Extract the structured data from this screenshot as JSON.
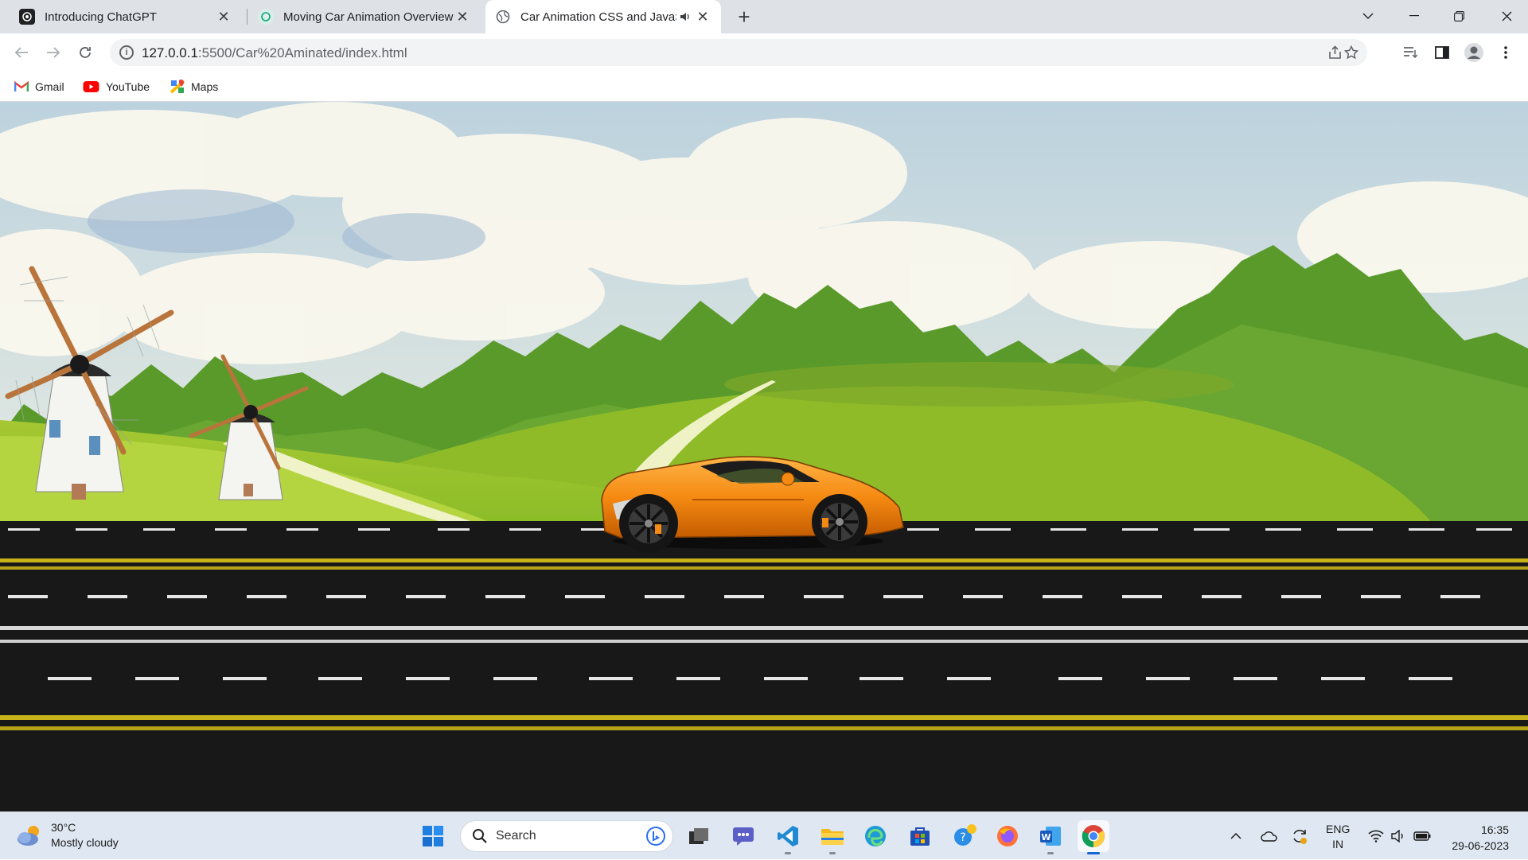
{
  "browser": {
    "tabs": [
      {
        "title": "Introducing ChatGPT",
        "close": "✕"
      },
      {
        "title": "Moving Car Animation Overview",
        "close": "✕"
      },
      {
        "title": "Car Animation CSS and JavaS",
        "close": "✕"
      }
    ],
    "new_tab": "+",
    "address": {
      "host": "127.0.0.1",
      "path": ":5500/Car%20Aminated/index.html"
    },
    "bookmarks": [
      "Gmail",
      "YouTube",
      "Maps"
    ]
  },
  "taskbar": {
    "weather": {
      "temp": "30°C",
      "desc": "Mostly cloudy"
    },
    "search_label": "Search",
    "language": [
      "ENG",
      "IN"
    ],
    "time": "16:35",
    "date": "29-06-2023"
  },
  "colors": {
    "sky_top": "#c9d9df",
    "sky_bottom": "#dfe6e0",
    "tree_green": "#5a9a2a",
    "grass": "#9cc42c",
    "road": "#141414",
    "road_yellow": "#c8b21a",
    "car_orange": "#f58a12",
    "taskbar": "#dfe8f2",
    "active_indicator": "#1466d6"
  }
}
